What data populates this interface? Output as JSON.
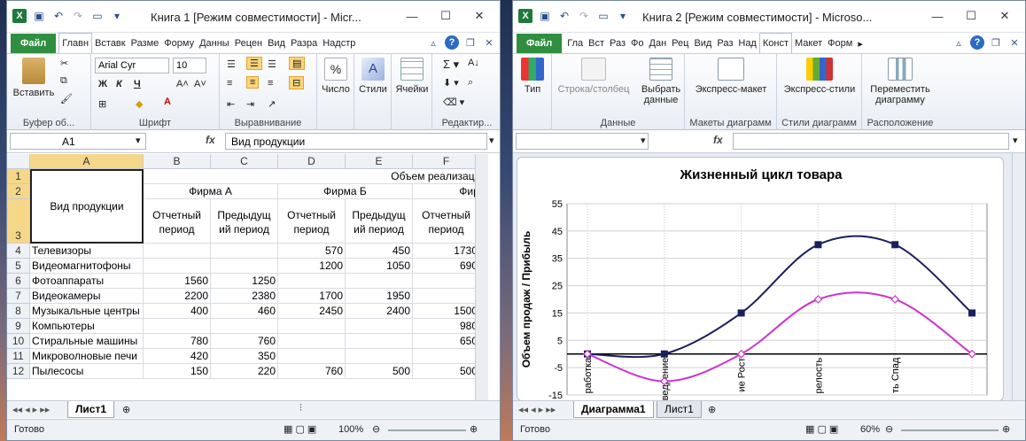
{
  "window1": {
    "title": "Книга 1  [Режим совместимости] - Micr...",
    "tabs": [
      "Файл",
      "Главн",
      "Вставк",
      "Разме",
      "Форму",
      "Данны",
      "Рецен",
      "Вид",
      "Разра",
      "Надстр"
    ],
    "ribbon": {
      "paste": "Вставить",
      "clipboard": "Буфер об...",
      "font_name": "Arial Cyr",
      "font_size": "10",
      "font_group": "Шрифт",
      "align_group": "Выравнивание",
      "number": "Число",
      "styles": "Стили",
      "cells": "Ячейки",
      "editing": "Редактир...",
      "bold": "Ж",
      "italic": "К",
      "underline": "Ч"
    },
    "namebox": "A1",
    "formula": "Вид продукции",
    "columns": [
      "A",
      "B",
      "C",
      "D",
      "E",
      "F"
    ],
    "rows": [
      "1",
      "2",
      "3",
      "4",
      "5",
      "6",
      "7",
      "8",
      "9",
      "10",
      "11",
      "12"
    ],
    "header": {
      "product": "Вид продукции",
      "volume": "Объем реализации",
      "firm_a": "Фирма А",
      "firm_b": "Фирма Б",
      "firm_c": "Фирм",
      "reporting": "Отчетный период",
      "previous": "Предыдущ ий период",
      "cut": "П"
    },
    "data": [
      [
        "Телевизоры",
        "",
        "",
        "570",
        "450",
        "1730"
      ],
      [
        "Видеомагнитофоны",
        "",
        "",
        "1200",
        "1050",
        "690"
      ],
      [
        "Фотоаппараты",
        "1560",
        "1250",
        "",
        "",
        ""
      ],
      [
        "Видеокамеры",
        "2200",
        "2380",
        "1700",
        "1950",
        ""
      ],
      [
        "Музыкальные центры",
        "400",
        "460",
        "2450",
        "2400",
        "1500"
      ],
      [
        "Компьютеры",
        "",
        "",
        "",
        "",
        "980"
      ],
      [
        "Стиральные машины",
        "780",
        "760",
        "",
        "",
        "650"
      ],
      [
        "Микроволновые печи",
        "420",
        "350",
        "",
        "",
        ""
      ],
      [
        "Пылесосы",
        "150",
        "220",
        "760",
        "500",
        "500"
      ]
    ],
    "sheet_tab": "Лист1",
    "status_ready": "Готово",
    "zoom": "100%"
  },
  "window2": {
    "title": "Книга 2  [Режим совместимости] - Microso...",
    "tabs": [
      "Файл",
      "Гла",
      "Вст",
      "Раз",
      "Фо",
      "Дан",
      "Рец",
      "Вид",
      "Раз",
      "Над",
      "Конст",
      "Макет",
      "Форм"
    ],
    "ribbon": {
      "type": "Тип",
      "row_col": "Строка/столбец",
      "select_data": "Выбрать данные",
      "data_group": "Данные",
      "express_layout": "Экспресс-макет",
      "layouts_group": "Макеты диаграмм",
      "express_styles": "Экспресс-стили",
      "styles_group": "Стили диаграмм",
      "move_chart": "Переместить диаграмму",
      "location_group": "Расположение"
    },
    "sheet_tabs": [
      "Диаграмма1",
      "Лист1"
    ],
    "status_ready": "Готово",
    "zoom": "60%"
  },
  "chart_data": {
    "type": "line",
    "title": "Жизненный цикл товара",
    "ylabel": "Объем продаж / Прибыль",
    "ylim": [
      -15,
      55
    ],
    "yticks": [
      -15,
      -5,
      5,
      15,
      25,
      35,
      45,
      55
    ],
    "categories": [
      "Разработка",
      "Внедрение",
      "Рост",
      "Зрелость",
      "Спад"
    ],
    "x_tick_labels": [
      "работка",
      "ведрение",
      "ие Рост",
      "релость",
      "ть Спад"
    ],
    "series": [
      {
        "name": "",
        "color": "#1a1f5e",
        "x": [
          0,
          1,
          2,
          3,
          4,
          5
        ],
        "values": [
          0,
          0,
          15,
          40,
          40,
          15
        ]
      },
      {
        "name": "",
        "color": "#cc33cc",
        "x": [
          0,
          1,
          2,
          3,
          4,
          5
        ],
        "values": [
          0,
          -10,
          0,
          20,
          20,
          0
        ]
      }
    ],
    "grid": true
  }
}
